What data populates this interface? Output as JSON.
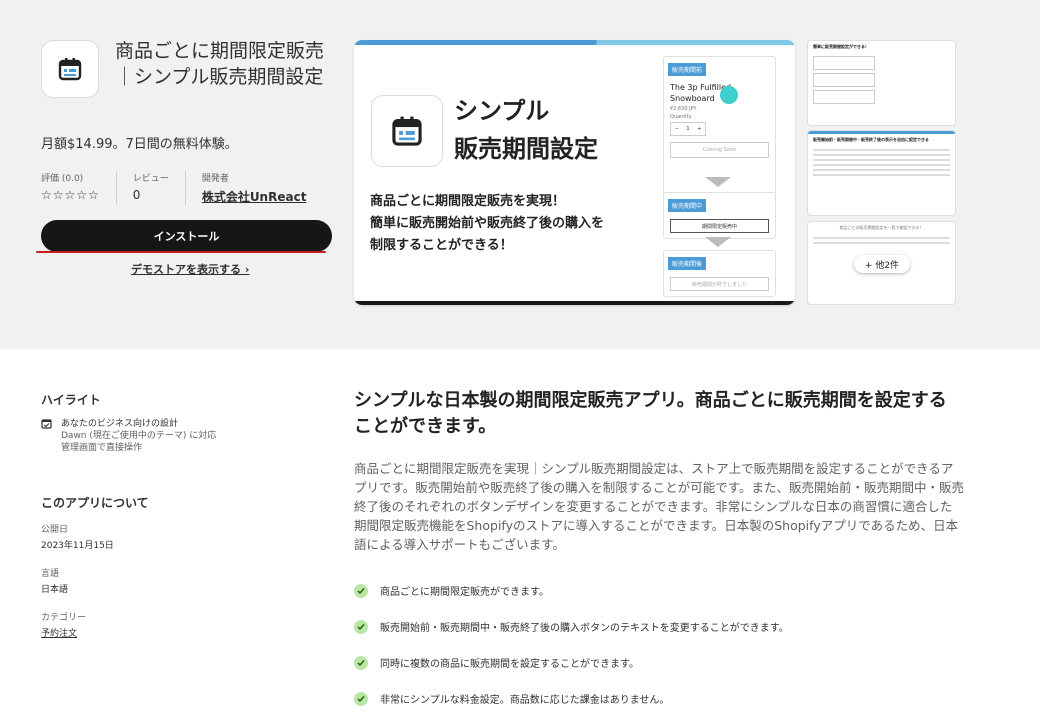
{
  "app": {
    "title": "商品ごとに期間限定販売｜シンプル販売期間設定",
    "price": "月額$14.99。7日間の無料体験。",
    "rating_label": "評価 (0.0)",
    "rating_stars": "☆☆☆☆☆",
    "reviews_label": "レビュー",
    "reviews_count": "0",
    "developer_label": "開発者",
    "developer_name": "株式会社UnReact",
    "install_label": "インストール",
    "demo_label": "デモストアを表示する ›"
  },
  "hero": {
    "heading_line1": "シンプル",
    "heading_line2": "販売期間設定",
    "text_line1": "商品ごとに期間限定販売を実現！",
    "text_line2": "簡単に販売開始前や販売終了後の購入を",
    "text_line3": "制限することができる！",
    "panel1_tag": "販売期間前",
    "product_name": "The 3p Fulfilled Snowboard",
    "product_price": "¥2,630 JPY",
    "quantity_label": "Quantity",
    "quantity_value": "1",
    "coming_soon": "Coming Soon",
    "panel2_tag": "販売期間中",
    "panel2_button": "期間限定販売中",
    "panel3_tag": "販売期間後",
    "panel3_button": "販売期間が終了しました"
  },
  "thumbs": {
    "t1_title": "簡単に販売期間設定ができる！",
    "t2_title": "販売開始前・販売期間中・販売終了後の表示を自由に設定できる",
    "t3_title": "商品ごとの販売期間設定を一覧で確認できる！",
    "more_label": "+ 他2件"
  },
  "highlights": {
    "heading": "ハイライト",
    "item_title": "あなたのビジネス向けの設計",
    "item_sub1": "Dawn (現在ご使用中のテーマ) に対応",
    "item_sub2": "管理画面で直接操作"
  },
  "about": {
    "heading": "このアプリについて",
    "published_label": "公開日",
    "published_value": "2023年11月15日",
    "language_label": "言語",
    "language_value": "日本語",
    "category_label": "カテゴリー",
    "category_value": "予約注文"
  },
  "main": {
    "heading": "シンプルな日本製の期間限定販売アプリ。商品ごとに販売期間を設定することができます。",
    "description": "商品ごとに期間限定販売を実現｜シンプル販売期間設定は、ストア上で販売期間を設定することができるアプリです。販売開始前や販売終了後の購入を制限することが可能です。また、販売開始前・販売期間中・販売終了後のそれぞれのボタンデザインを変更することができます。非常にシンプルな日本の商習慣に適合した期間限定販売機能をShopifyのストアに導入することができます。日本製のShopifyアプリであるため、日本語による導入サポートもございます。",
    "features": [
      "商品ごとに期間限定販売ができます。",
      "販売開始前・販売期間中・販売終了後の購入ボタンのテキストを変更することができます。",
      "同時に複数の商品に販売期間を設定することができます。",
      "非常にシンプルな料金設定。商品数に応じた課金はありません。"
    ]
  },
  "colors": {
    "accent_blue": "#4a9bd6",
    "check_green": "#b9e6a5",
    "install_bg": "#161616"
  }
}
